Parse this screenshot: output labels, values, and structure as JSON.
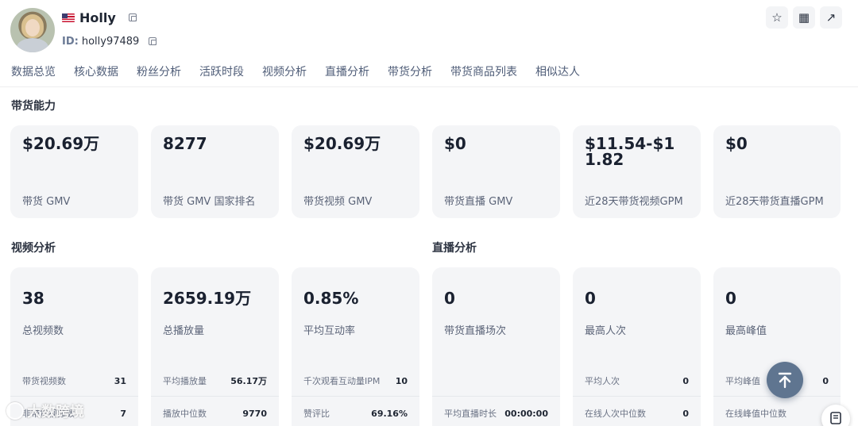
{
  "profile": {
    "name": "Holly",
    "id_label": "ID:",
    "id_value": "holly97489"
  },
  "actions": {
    "star_icon": "☆",
    "qr_icon": "▦",
    "share_icon": "↗"
  },
  "tabs": [
    {
      "label": "数据总览"
    },
    {
      "label": "核心数据"
    },
    {
      "label": "粉丝分析"
    },
    {
      "label": "活跃时段"
    },
    {
      "label": "视频分析"
    },
    {
      "label": "直播分析"
    },
    {
      "label": "带货分析"
    },
    {
      "label": "带货商品列表"
    },
    {
      "label": "相似达人"
    }
  ],
  "sales": {
    "title": "带货能力",
    "cards": [
      {
        "value": "$20.69万",
        "label": "带货 GMV"
      },
      {
        "value": "8277",
        "label": "带货 GMV 国家排名"
      },
      {
        "value": "$20.69万",
        "label": "带货视频 GMV"
      },
      {
        "value": "$0",
        "label": "带货直播 GMV"
      },
      {
        "value": "$11.54-$11.82",
        "label": "近28天带货视频GPM"
      },
      {
        "value": "$0",
        "label": "近28天带货直播GPM"
      }
    ]
  },
  "video": {
    "title": "视频分析",
    "cards": [
      {
        "value": "38",
        "label": "总视频数",
        "rows": [
          {
            "k": "带货视频数",
            "v": "31"
          },
          {
            "k": "非带货视频数",
            "v": "7"
          }
        ]
      },
      {
        "value": "2659.19万",
        "label": "总播放量",
        "rows": [
          {
            "k": "平均播放量",
            "v": "56.17万"
          },
          {
            "k": "播放中位数",
            "v": "9770"
          }
        ]
      },
      {
        "value": "0.85%",
        "label": "平均互动率",
        "rows": [
          {
            "k": "千次观看互动量IPM",
            "v": "10"
          },
          {
            "k": "赞评比",
            "v": "69.16%"
          }
        ]
      }
    ]
  },
  "live": {
    "title": "直播分析",
    "cards": [
      {
        "value": "0",
        "label": "带货直播场次",
        "rows": [
          {
            "k": "",
            "v": ""
          },
          {
            "k": "平均直播时长",
            "v": "00:00:00"
          }
        ]
      },
      {
        "value": "0",
        "label": "最高人次",
        "rows": [
          {
            "k": "平均人次",
            "v": "0"
          },
          {
            "k": "在线人次中位数",
            "v": "0"
          }
        ]
      },
      {
        "value": "0",
        "label": "最高峰值",
        "rows": [
          {
            "k": "平均峰值",
            "v": "0"
          },
          {
            "k": "在线峰值中位数",
            "v": ""
          }
        ]
      }
    ]
  },
  "watermark": {
    "text": "大数跨境"
  },
  "icons": {
    "fab": "arrow-up-icon",
    "doc": "document-icon"
  }
}
